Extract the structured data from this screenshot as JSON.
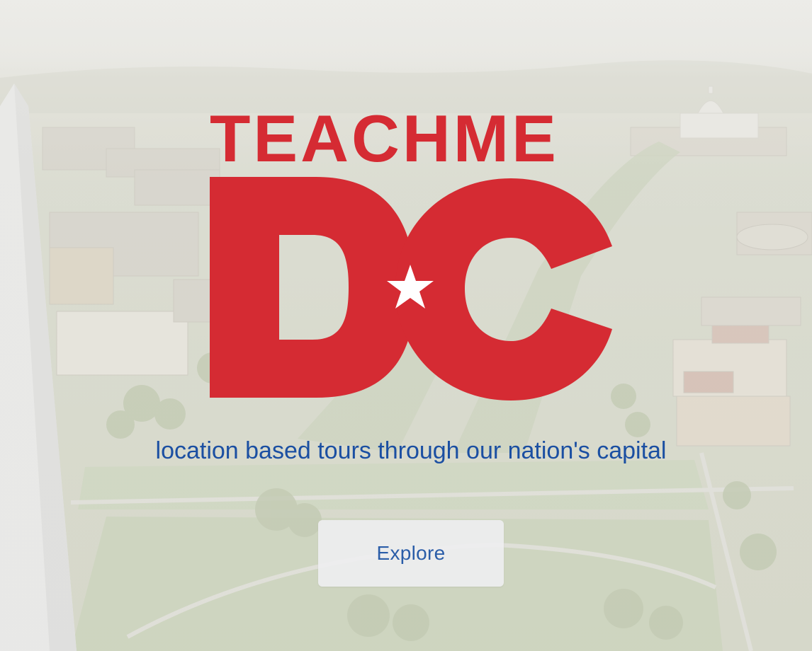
{
  "logo": {
    "top_text": "TEACHME",
    "main_text": "DC",
    "color": "#d52b33",
    "star_color": "#ffffff",
    "icon": "star-icon"
  },
  "tagline": "location based tours through our nation's capital",
  "tagline_color": "#1b4fa2",
  "explore_button": {
    "label": "Explore",
    "color": "#2a5da8"
  }
}
